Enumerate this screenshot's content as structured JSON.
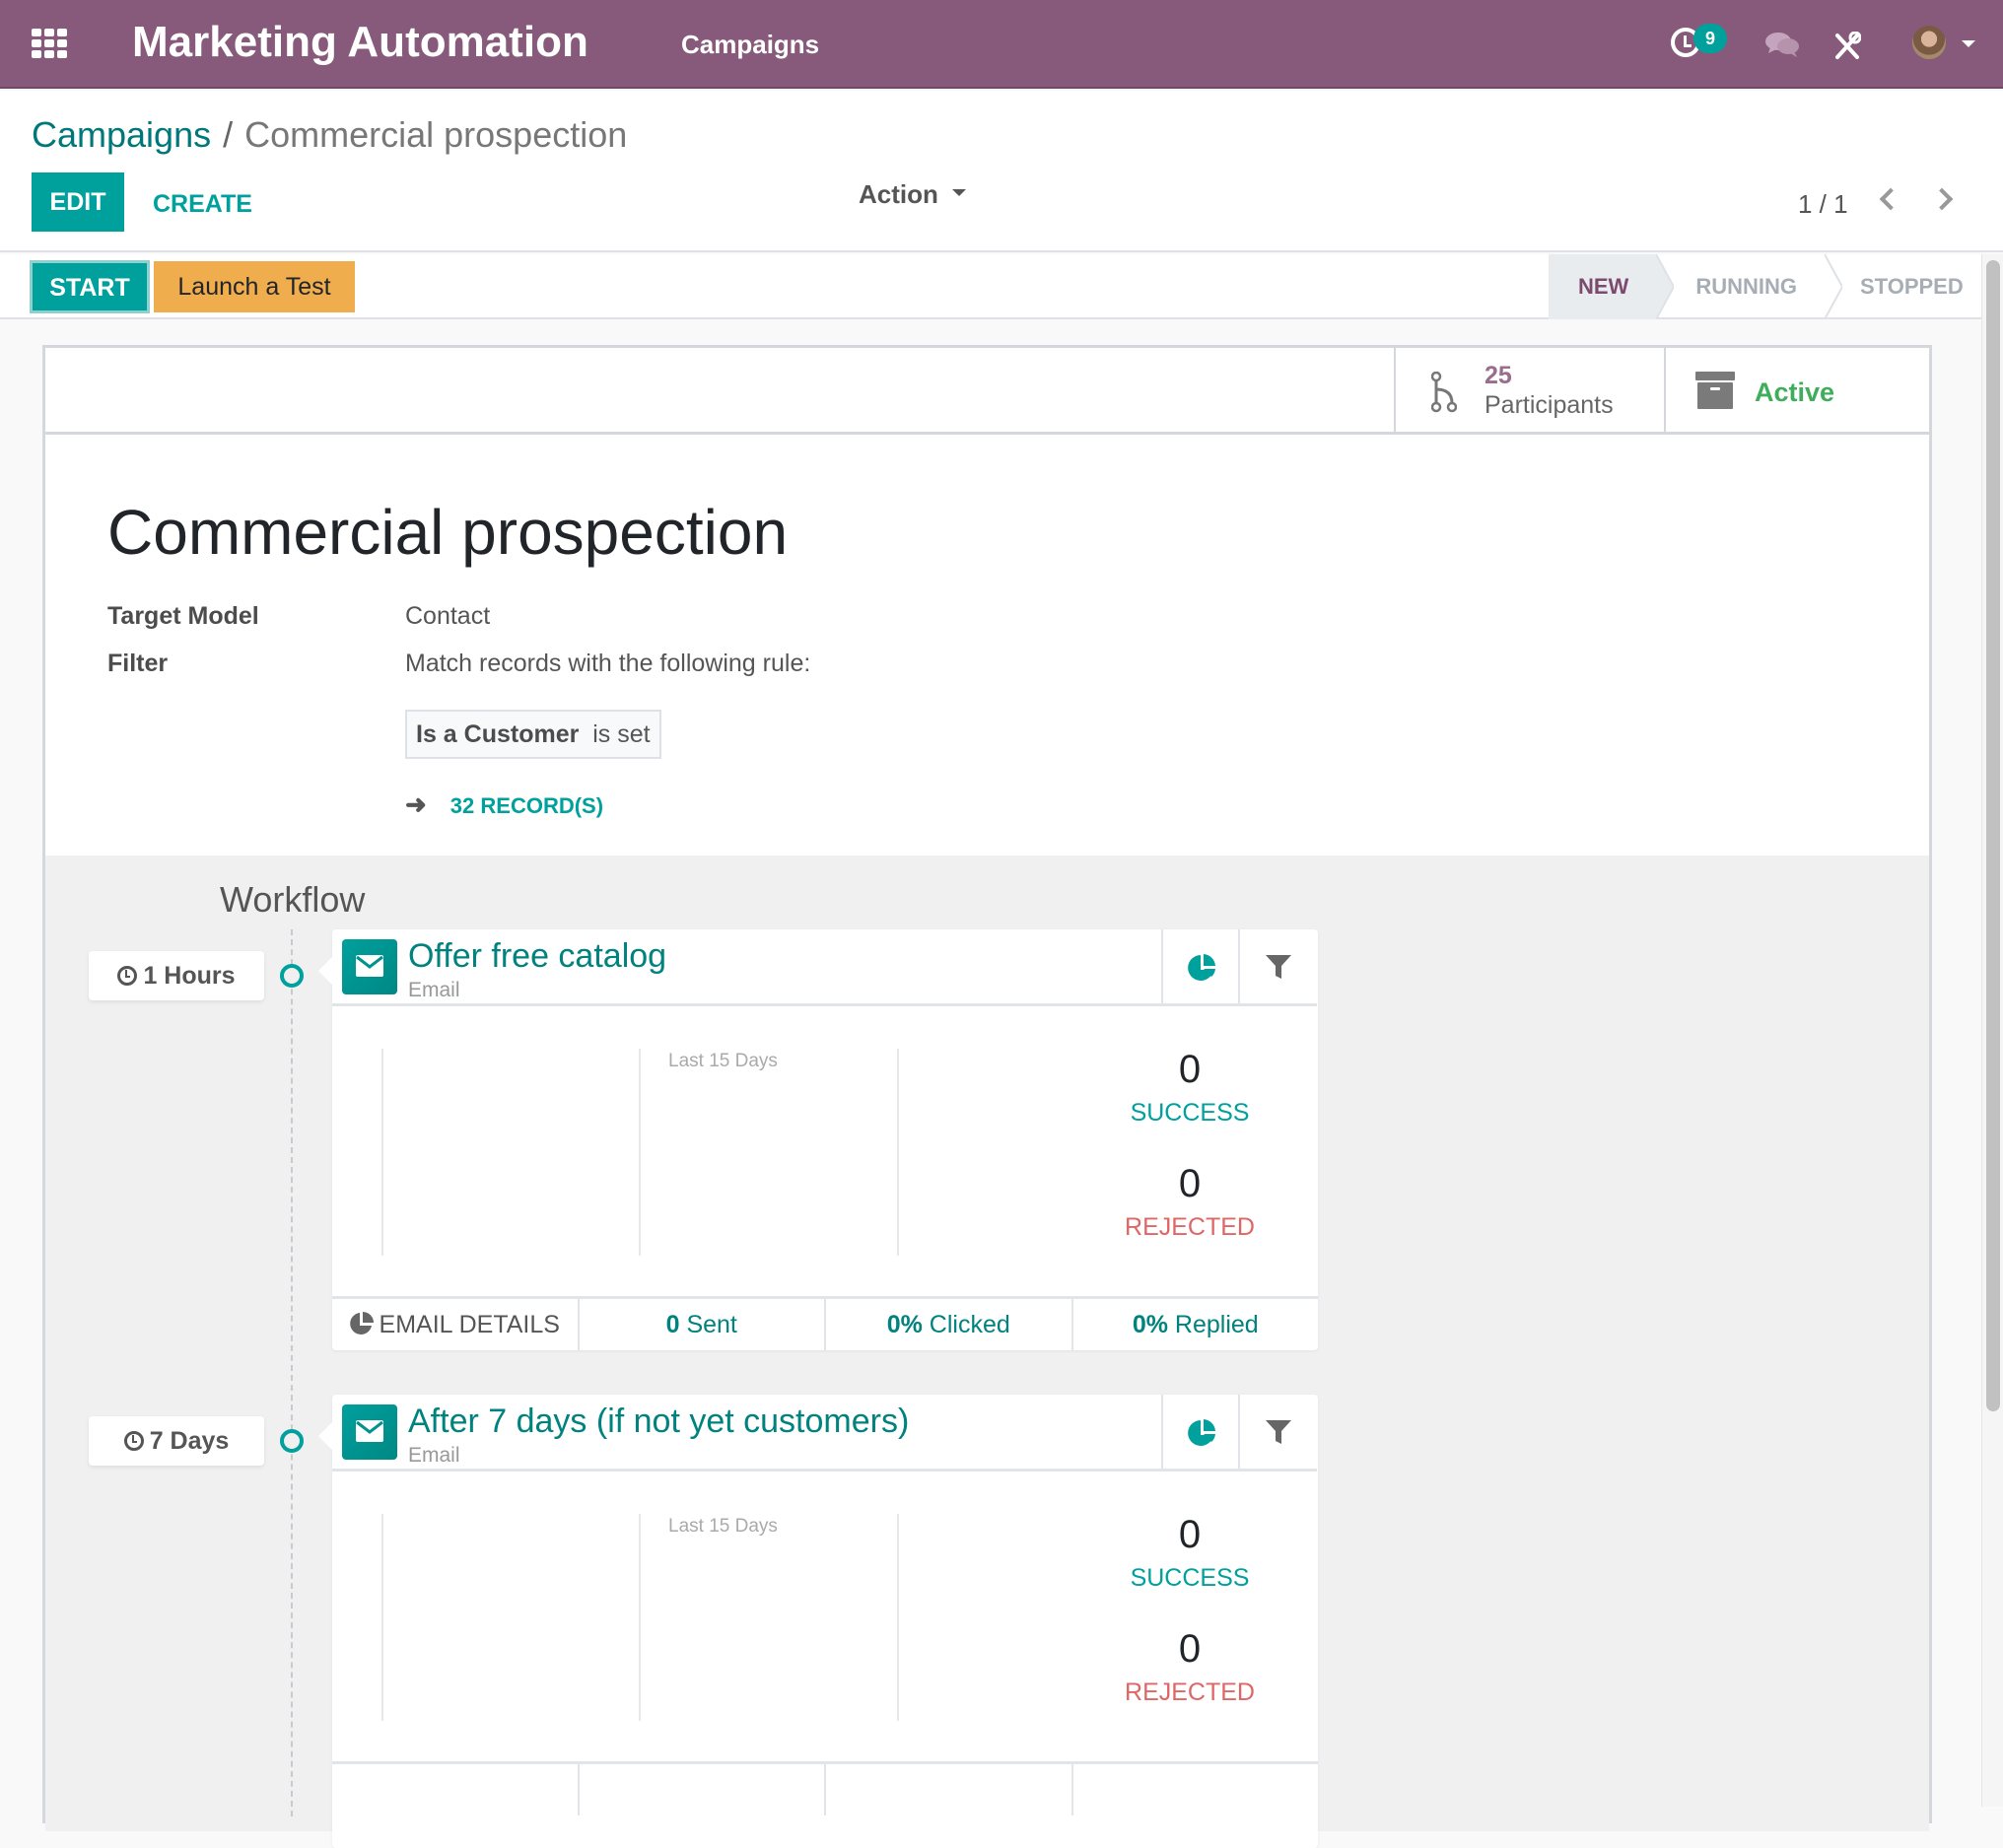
{
  "navbar": {
    "app_title": "Marketing Automation",
    "menu_items": [
      "Campaigns"
    ],
    "activity_badge_count": "9",
    "icons": [
      "apps-grid-icon",
      "activity-clock-icon",
      "chat-icon",
      "tools-icon",
      "user-avatar"
    ],
    "brand_color": "#875A7B"
  },
  "breadcrumb": {
    "parent": "Campaigns",
    "separator": "/",
    "current": "Commercial prospection"
  },
  "toolbar": {
    "edit_label": "EDIT",
    "create_label": "CREATE",
    "action_label": "Action",
    "pager": "1 / 1"
  },
  "statusbar": {
    "start_label": "START",
    "test_label": "Launch a Test",
    "steps": [
      {
        "label": "NEW",
        "active": true
      },
      {
        "label": "RUNNING",
        "active": false
      },
      {
        "label": "STOPPED",
        "active": false
      }
    ]
  },
  "stat_buttons": {
    "participants_value": "25",
    "participants_label": "Participants",
    "active_label": "Active"
  },
  "record": {
    "title": "Commercial prospection",
    "fields": [
      {
        "label": "Target Model",
        "value": "Contact"
      },
      {
        "label": "Filter",
        "value": "Match records with the following rule:"
      }
    ],
    "filter_rule": {
      "field": "Is a Customer",
      "operator": "is set"
    },
    "records_link": "32 RECORD(S)"
  },
  "workflow": {
    "title": "Workflow",
    "activities": [
      {
        "delay": "1 Hours",
        "name": "Offer free catalog",
        "type": "Email",
        "period_label": "Last 15 Days",
        "success_count": "0",
        "success_label": "SUCCESS",
        "rejected_count": "0",
        "rejected_label": "REJECTED",
        "footer": {
          "details_label": "EMAIL DETAILS",
          "sent": "0",
          "sent_label": "Sent",
          "clicked": "0%",
          "clicked_label": "Clicked",
          "replied": "0%",
          "replied_label": "Replied"
        }
      },
      {
        "delay": "7 Days",
        "name": "After 7 days (if not yet customers)",
        "type": "Email",
        "period_label": "Last 15 Days",
        "success_count": "0",
        "success_label": "SUCCESS",
        "rejected_count": "0",
        "rejected_label": "REJECTED"
      }
    ]
  }
}
